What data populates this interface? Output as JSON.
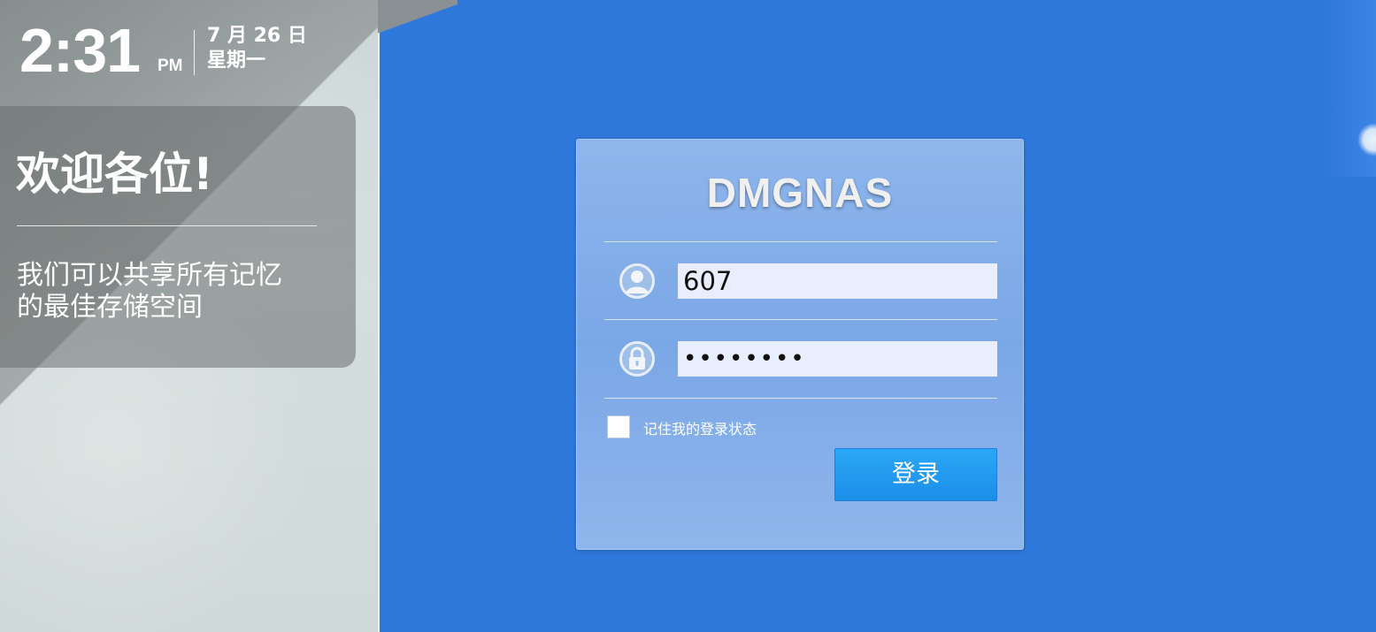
{
  "clock": {
    "time": "2:31",
    "ampm": "PM",
    "date": "7 月 26 日",
    "weekday": "星期一"
  },
  "welcome": {
    "title": "欢迎各位!",
    "line1": "我们可以共享所有记忆",
    "line2": "的最佳存储空间"
  },
  "login": {
    "title": "DMGNAS",
    "username_value": "607",
    "password_value": "••••••••",
    "user_icon": "user-icon",
    "lock_icon": "lock-icon",
    "remember_label": "记住我的登录状态",
    "remember_checked": false,
    "submit_label": "登录"
  },
  "colors": {
    "background": "#2f78db",
    "login_card": "#86afe9",
    "button": "#2196ee",
    "input": "#e8eefd"
  }
}
